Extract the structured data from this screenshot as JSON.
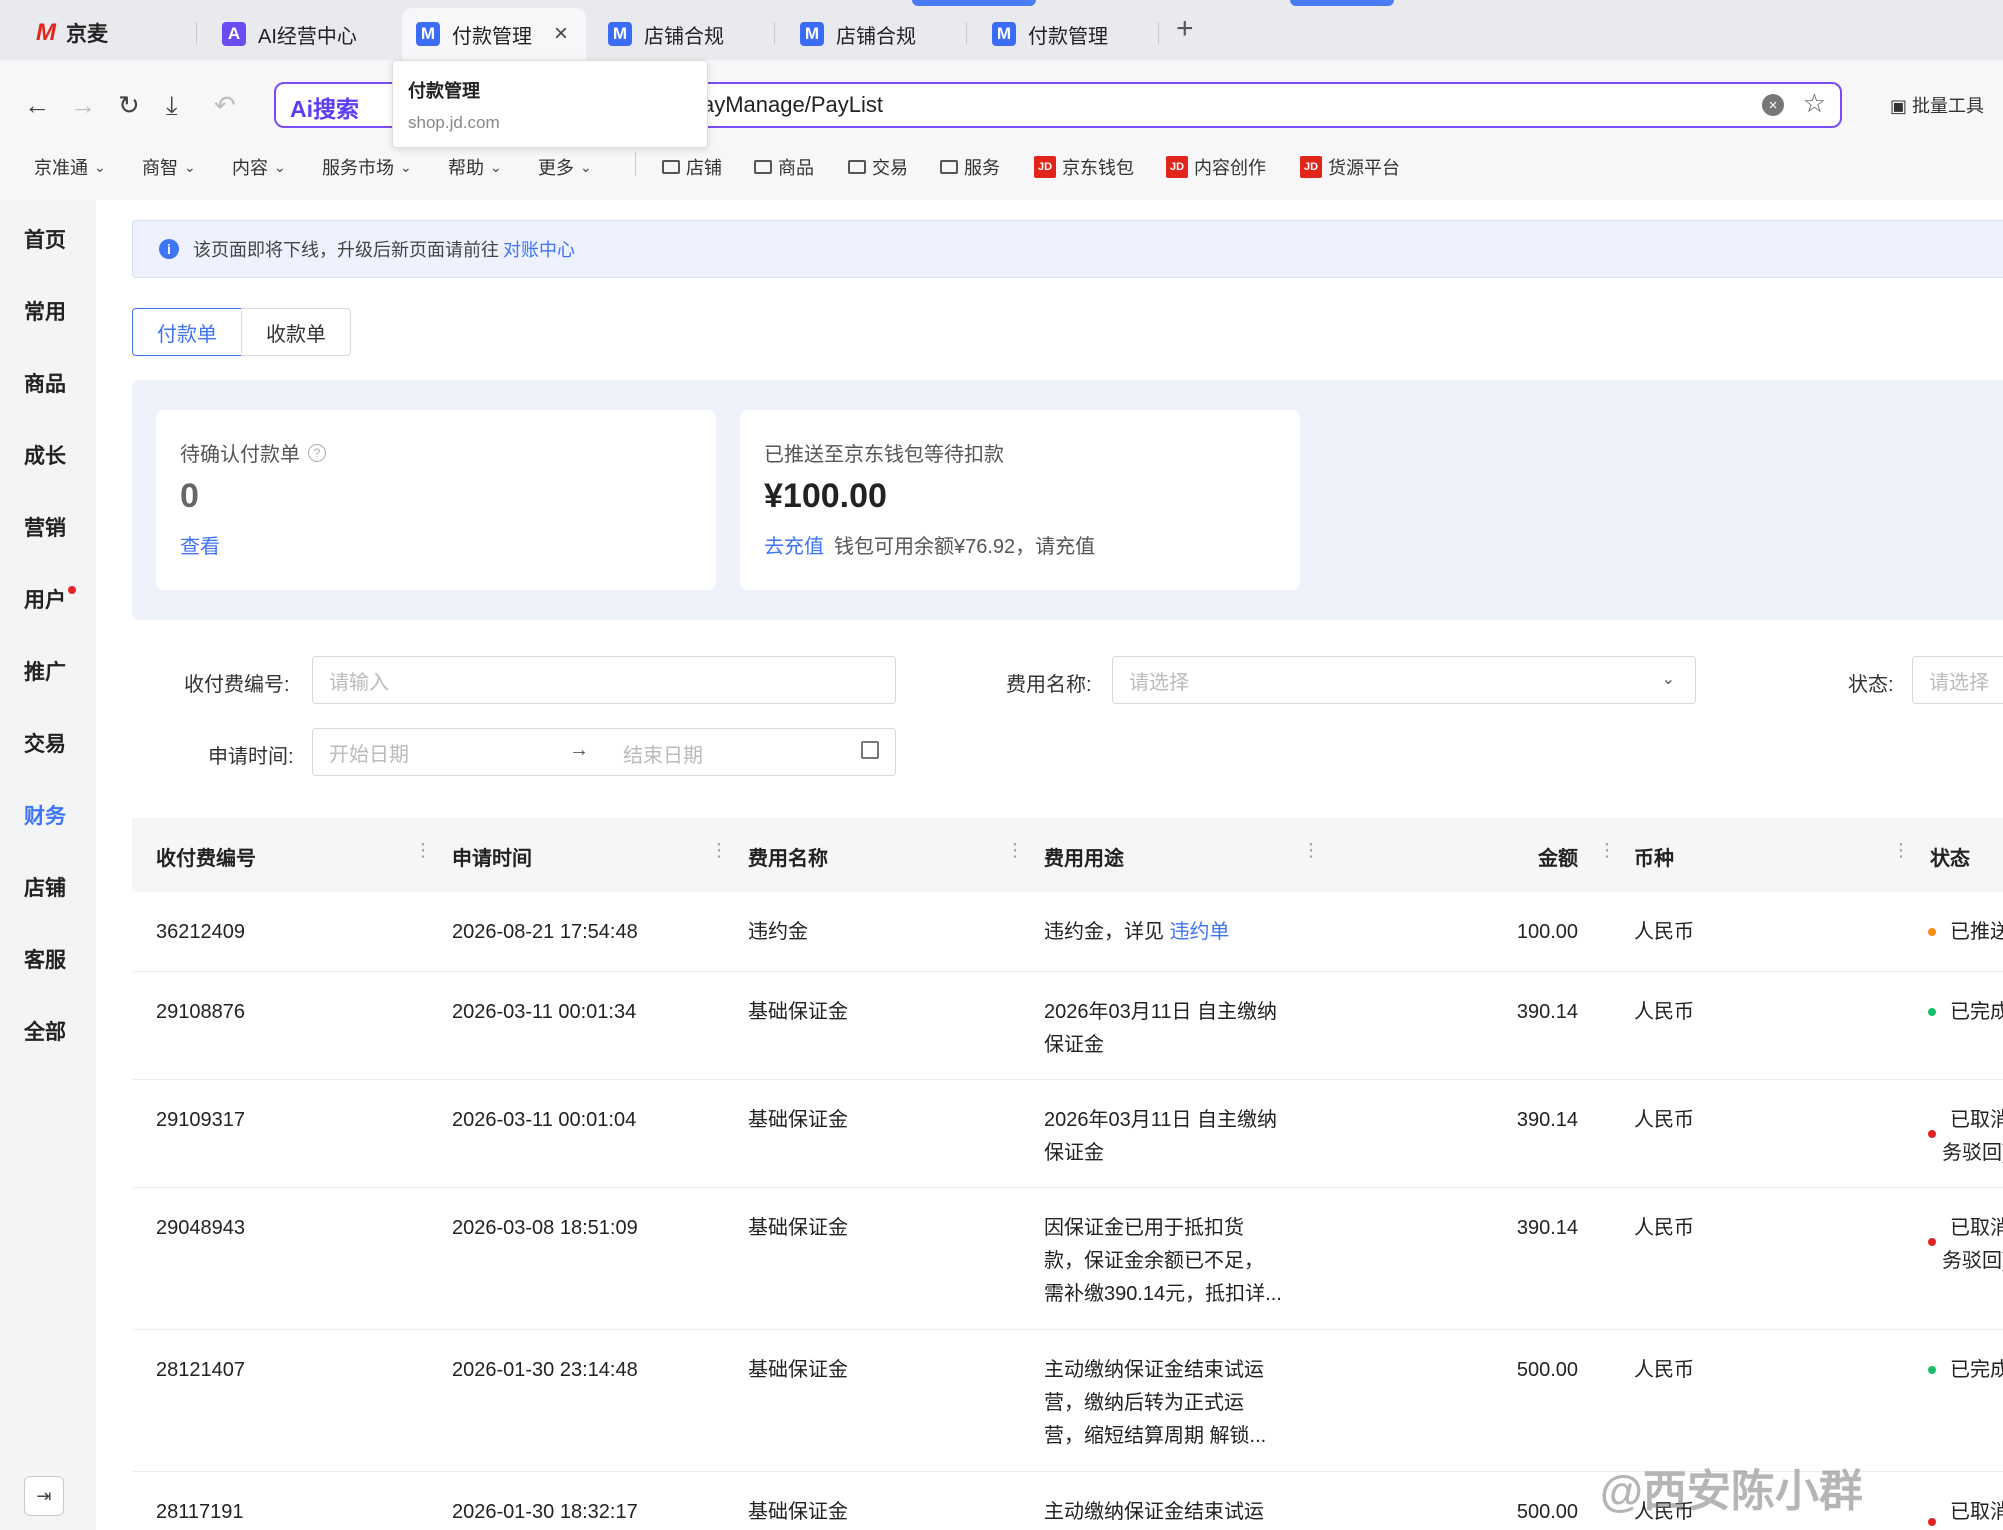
{
  "browser": {
    "brand": "京麦",
    "tabs": [
      {
        "label": "AI经营中心",
        "icon": "ai-icon"
      },
      {
        "label": "付款管理",
        "icon": "m-icon",
        "active": true
      },
      {
        "label": "店铺合规",
        "icon": "m-icon"
      },
      {
        "label": "店铺合规",
        "icon": "m-icon"
      },
      {
        "label": "付款管理",
        "icon": "m-icon"
      }
    ],
    "new_tab": "+",
    "ai_search": "Ai搜索",
    "url": "ayManage/PayList",
    "bulk_tools": "批量工具",
    "tooltip": {
      "title": "付款管理",
      "domain": "shop.jd.com"
    }
  },
  "bookmarks": {
    "menus": [
      "京准通",
      "商智",
      "内容",
      "服务市场",
      "帮助",
      "更多"
    ],
    "folders": [
      "店铺",
      "商品",
      "交易",
      "服务"
    ],
    "jd_links": [
      "京东钱包",
      "内容创作",
      "货源平台"
    ]
  },
  "sidebar": {
    "items": [
      "首页",
      "常用",
      "商品",
      "成长",
      "营销",
      "用户",
      "推广",
      "交易",
      "财务",
      "店铺",
      "客服",
      "全部"
    ],
    "active": "财务"
  },
  "notice": {
    "text": "该页面即将下线，升级后新页面请前往",
    "link": "对账中心"
  },
  "segments": [
    "付款单",
    "收款单"
  ],
  "summary": {
    "pending": {
      "label": "待确认付款单",
      "value": "0",
      "link": "查看"
    },
    "pushed": {
      "label": "已推送至京东钱包等待扣款",
      "value": "¥100.00",
      "link": "去充值",
      "note": "钱包可用余额¥76.92，请充值"
    }
  },
  "filters": {
    "fee_no": {
      "label": "收付费编号:",
      "placeholder": "请输入"
    },
    "fee_name": {
      "label": "费用名称:",
      "placeholder": "请选择"
    },
    "status": {
      "label": "状态:",
      "placeholder": "请选择"
    },
    "apply_time": {
      "label": "申请时间:",
      "start": "开始日期",
      "end": "结束日期",
      "sep": "→"
    }
  },
  "table": {
    "headers": [
      "收付费编号",
      "申请时间",
      "费用名称",
      "费用用途",
      "金额",
      "币种",
      "状态"
    ],
    "rows": [
      {
        "id": "36212409",
        "time": "2026-08-21 17:54:48",
        "name": "违约金",
        "use": [
          "违约金，详见"
        ],
        "use_link": "违约单",
        "amount": "100.00",
        "currency": "人民币",
        "status": [
          "已推送"
        ],
        "status_color": "#fa8c16"
      },
      {
        "id": "29108876",
        "time": "2026-03-11 00:01:34",
        "name": "基础保证金",
        "use": [
          "2026年03月11日 自主缴纳",
          "保证金"
        ],
        "amount": "390.14",
        "currency": "人民币",
        "status": [
          "已完成"
        ],
        "status_color": "#19be6b"
      },
      {
        "id": "29109317",
        "time": "2026-03-11 00:01:04",
        "name": "基础保证金",
        "use": [
          "2026年03月11日 自主缴纳",
          "保证金"
        ],
        "amount": "390.14",
        "currency": "人民币",
        "status": [
          "已取消(",
          "务驳回)"
        ],
        "status_color": "#e02424"
      },
      {
        "id": "29048943",
        "time": "2026-03-08 18:51:09",
        "name": "基础保证金",
        "use": [
          "因保证金已用于抵扣货",
          "款，保证金余额已不足，",
          "需补缴390.14元，抵扣详..."
        ],
        "amount": "390.14",
        "currency": "人民币",
        "status": [
          "已取消(",
          "务驳回)"
        ],
        "status_color": "#e02424"
      },
      {
        "id": "28121407",
        "time": "2026-01-30 23:14:48",
        "name": "基础保证金",
        "use": [
          "主动缴纳保证金结束试运",
          "营，缴纳后转为正式运",
          "营，缩短结算周期 解锁..."
        ],
        "amount": "500.00",
        "currency": "人民币",
        "status": [
          "已完成"
        ],
        "status_color": "#19be6b"
      },
      {
        "id": "28117191",
        "time": "2026-01-30 18:32:17",
        "name": "基础保证金",
        "use": [
          "主动缴纳保证金结束试运"
        ],
        "amount": "500.00",
        "currency": "人民币",
        "status": [
          "已取消"
        ],
        "status_color": "#e02424"
      }
    ]
  },
  "watermark": "@西安陈小群"
}
